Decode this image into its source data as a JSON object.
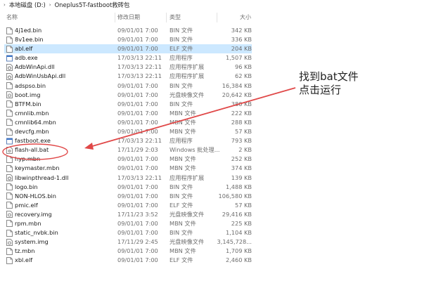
{
  "breadcrumb": {
    "items": [
      "本地磁盘 (D:)",
      "Oneplus5T-fastboot救砖包"
    ]
  },
  "columns": {
    "name": "名称",
    "date": "修改日期",
    "type": "类型",
    "size": "大小"
  },
  "files": [
    {
      "name": "4j1ed.bin",
      "date": "09/01/01 7:00",
      "type": "BIN 文件",
      "size": "342 KB",
      "icon": "generic-file-icon"
    },
    {
      "name": "8v1ee.bin",
      "date": "09/01/01 7:00",
      "type": "BIN 文件",
      "size": "336 KB",
      "icon": "generic-file-icon"
    },
    {
      "name": "abl.elf",
      "date": "09/01/01 7:00",
      "type": "ELF 文件",
      "size": "204 KB",
      "icon": "generic-file-icon",
      "selected": true
    },
    {
      "name": "adb.exe",
      "date": "17/03/13 22:11",
      "type": "应用程序",
      "size": "1,507 KB",
      "icon": "exe-icon"
    },
    {
      "name": "AdbWinApi.dll",
      "date": "17/03/13 22:11",
      "type": "应用程序扩展",
      "size": "96 KB",
      "icon": "dll-icon"
    },
    {
      "name": "AdbWinUsbApi.dll",
      "date": "17/03/13 22:11",
      "type": "应用程序扩展",
      "size": "62 KB",
      "icon": "dll-icon"
    },
    {
      "name": "adspso.bin",
      "date": "09/01/01 7:00",
      "type": "BIN 文件",
      "size": "16,384 KB",
      "icon": "generic-file-icon"
    },
    {
      "name": "boot.img",
      "date": "09/01/01 7:00",
      "type": "光盘映像文件",
      "size": "20,642 KB",
      "icon": "disc-image-icon"
    },
    {
      "name": "BTFM.bin",
      "date": "09/01/01 7:00",
      "type": "BIN 文件",
      "size": "380 KB",
      "icon": "generic-file-icon"
    },
    {
      "name": "cmnlib.mbn",
      "date": "09/01/01 7:00",
      "type": "MBN 文件",
      "size": "222 KB",
      "icon": "generic-file-icon"
    },
    {
      "name": "cmnlib64.mbn",
      "date": "09/01/01 7:00",
      "type": "MBN 文件",
      "size": "288 KB",
      "icon": "generic-file-icon"
    },
    {
      "name": "devcfg.mbn",
      "date": "09/01/01 7:00",
      "type": "MBN 文件",
      "size": "57 KB",
      "icon": "generic-file-icon"
    },
    {
      "name": "fastboot.exe",
      "date": "17/03/13 22:11",
      "type": "应用程序",
      "size": "793 KB",
      "icon": "exe-icon"
    },
    {
      "name": "flash-all.bat",
      "date": "17/11/29 2:03",
      "type": "Windows 批处理...",
      "size": "2 KB",
      "icon": "batch-file-icon"
    },
    {
      "name": "hyp.mbn",
      "date": "09/01/01 7:00",
      "type": "MBN 文件",
      "size": "252 KB",
      "icon": "generic-file-icon"
    },
    {
      "name": "keymaster.mbn",
      "date": "09/01/01 7:00",
      "type": "MBN 文件",
      "size": "374 KB",
      "icon": "generic-file-icon"
    },
    {
      "name": "libwinpthread-1.dll",
      "date": "17/03/13 22:11",
      "type": "应用程序扩展",
      "size": "139 KB",
      "icon": "dll-icon"
    },
    {
      "name": "logo.bin",
      "date": "09/01/01 7:00",
      "type": "BIN 文件",
      "size": "1,488 KB",
      "icon": "generic-file-icon"
    },
    {
      "name": "NON-HLOS.bin",
      "date": "09/01/01 7:00",
      "type": "BIN 文件",
      "size": "106,580 KB",
      "icon": "generic-file-icon"
    },
    {
      "name": "pmic.elf",
      "date": "09/01/01 7:00",
      "type": "ELF 文件",
      "size": "57 KB",
      "icon": "generic-file-icon"
    },
    {
      "name": "recovery.img",
      "date": "17/11/23 3:52",
      "type": "光盘映像文件",
      "size": "29,416 KB",
      "icon": "disc-image-icon"
    },
    {
      "name": "rpm.mbn",
      "date": "09/01/01 7:00",
      "type": "MBN 文件",
      "size": "225 KB",
      "icon": "generic-file-icon"
    },
    {
      "name": "static_nvbk.bin",
      "date": "09/01/01 7:00",
      "type": "BIN 文件",
      "size": "1,104 KB",
      "icon": "generic-file-icon"
    },
    {
      "name": "system.img",
      "date": "17/11/29 2:45",
      "type": "光盘映像文件",
      "size": "3,145,728...",
      "icon": "disc-image-icon"
    },
    {
      "name": "tz.mbn",
      "date": "09/01/01 7:00",
      "type": "MBN 文件",
      "size": "1,709 KB",
      "icon": "generic-file-icon"
    },
    {
      "name": "xbl.elf",
      "date": "09/01/01 7:00",
      "type": "ELF 文件",
      "size": "2,460 KB",
      "icon": "generic-file-icon"
    }
  ],
  "annotation": {
    "line1": "找到bat文件",
    "line2": "点击运行",
    "color": "#e04848"
  },
  "colors": {
    "selection": "#cce8ff",
    "header_text": "#6b6b6b",
    "secondary_text": "#6d6d6d"
  }
}
